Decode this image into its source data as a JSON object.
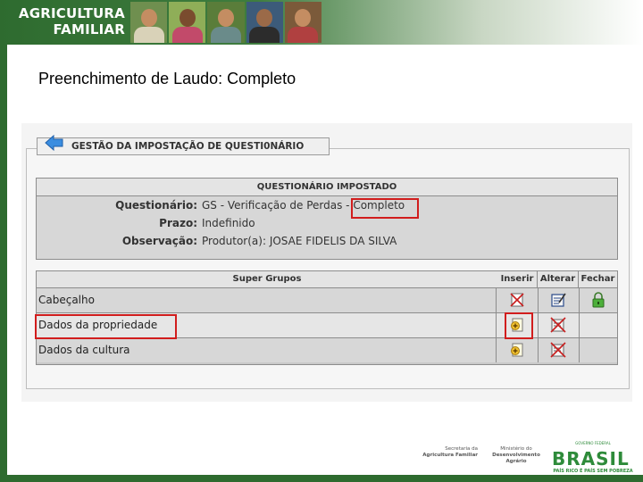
{
  "header": {
    "brand_line1": "AGRICULTURA",
    "brand_line2": "FAMILIAR",
    "photo_colors": [
      "#6f8f4f",
      "#8fae58",
      "#5a7d3a",
      "#3c5b7a",
      "#7b5a3a"
    ]
  },
  "slide_title": "Preenchimento de Laudo: Completo",
  "panel": {
    "legend": "GESTÃO DA IMPOSTAÇÃO DE QUESTI0NÁRIO",
    "back_icon": "back-arrow-icon"
  },
  "questionario": {
    "header": "QUESTIONÁRIO IMPOSTADO",
    "rows": [
      {
        "label": "Questionário:",
        "value": "GS - Verificação de Perdas - Completo"
      },
      {
        "label": "Prazo:",
        "value": "Indefinido"
      },
      {
        "label": "Observação:",
        "value": "Produtor(a): JOSAE FIDELIS DA SILVA"
      }
    ]
  },
  "super_grupos": {
    "headers": {
      "name": "Super Grupos",
      "inserir": "Inserir",
      "alterar": "Alterar",
      "fechar": "Fechar"
    },
    "rows": [
      {
        "name": "Cabeçalho",
        "inserir": "insert-disabled-icon",
        "alterar": "edit-icon",
        "fechar": "lock-icon"
      },
      {
        "name": "Dados da propriedade",
        "inserir": "insert-icon",
        "alterar": "edit-disabled-icon",
        "fechar": ""
      },
      {
        "name": "Dados da cultura",
        "inserir": "insert-icon",
        "alterar": "edit-disabled-icon",
        "fechar": ""
      }
    ]
  },
  "footer": {
    "secretaria_line1": "Secretaria da",
    "secretaria_line2": "Agricultura Familiar",
    "ministerio_line1": "Ministério do",
    "ministerio_line2": "Desenvolvimento Agrário",
    "brasil_top": "GOVERNO FEDERAL",
    "brasil": "BRASIL",
    "brasil_slogan": "PAÍS RICO É PAÍS SEM POBREZA"
  },
  "colors": {
    "brand_green": "#2e6b2f",
    "highlight_red": "#d11d1d",
    "table_gray": "#d7d7d7"
  }
}
